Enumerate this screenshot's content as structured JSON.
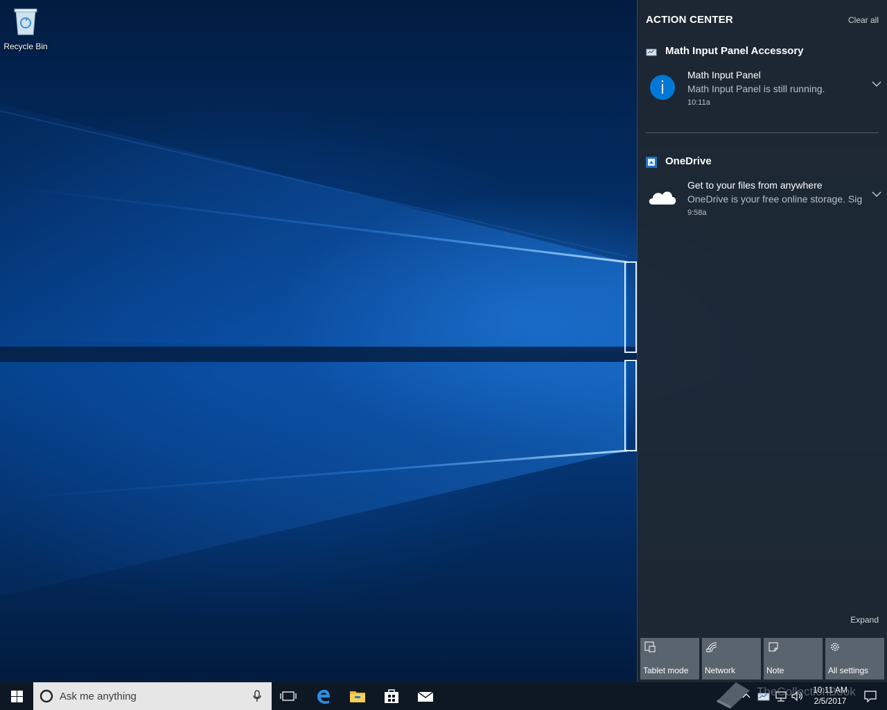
{
  "desktop": {
    "icons": [
      {
        "label": "Recycle Bin",
        "icon": "recycle-bin-icon"
      }
    ]
  },
  "action_center": {
    "title": "ACTION CENTER",
    "clear_all": "Clear all",
    "groups": [
      {
        "name": "Math Input Panel Accessory",
        "icon": "math-input-panel-icon",
        "notifications": [
          {
            "title": "Math Input Panel",
            "body": "Math Input Panel is still running.",
            "time": "10:11a",
            "icon": "info-icon"
          }
        ]
      },
      {
        "name": "OneDrive",
        "icon": "onedrive-icon",
        "notifications": [
          {
            "title": "Get to your files from anywhere",
            "body": "OneDrive is your free online storage. Sign in to get started.",
            "time": "9:58a",
            "icon": "cloud-icon"
          }
        ]
      }
    ],
    "expand": "Expand",
    "quick_actions": [
      {
        "label": "Tablet mode",
        "icon": "tablet-mode-icon"
      },
      {
        "label": "Network",
        "icon": "network-icon"
      },
      {
        "label": "Note",
        "icon": "note-icon"
      },
      {
        "label": "All settings",
        "icon": "gear-icon"
      }
    ]
  },
  "taskbar": {
    "search_placeholder": "Ask me anything",
    "pinned": [
      "task-view-icon",
      "edge-icon",
      "file-explorer-icon",
      "store-icon",
      "mail-icon"
    ],
    "clock": {
      "time": "10:11 AM",
      "date": "2/5/2017"
    }
  },
  "watermark": "TheCollectionBook",
  "colors": {
    "action_center_bg": "#1f2832",
    "quick_action_bg": "#5a646e",
    "info_blue": "#0078d7",
    "taskbar_bg": "#0d1824"
  }
}
